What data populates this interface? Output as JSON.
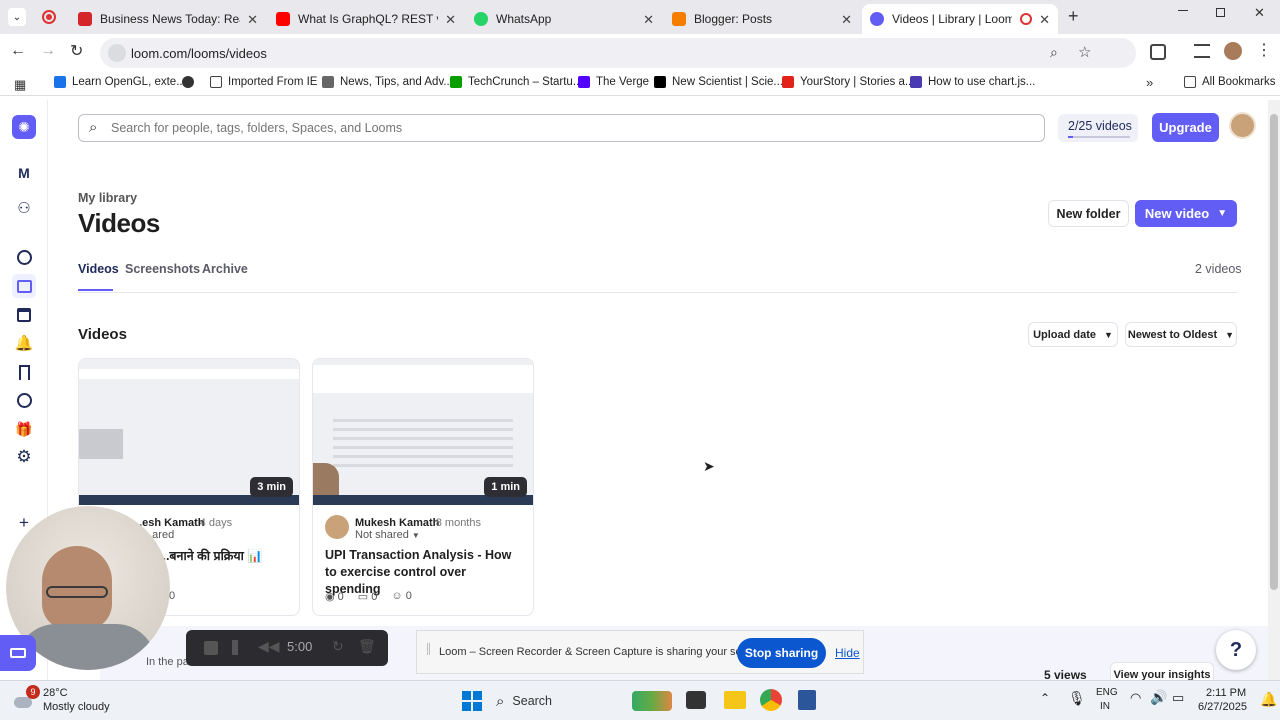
{
  "browser": {
    "tabs": [
      {
        "title": "Business News Today: Read Latest",
        "icon_color": "#d4262a"
      },
      {
        "title": "What Is GraphQL? REST vs. GraphQL",
        "icon_color": "#ff0000"
      },
      {
        "title": "WhatsApp",
        "icon_color": "#25d366"
      },
      {
        "title": "Blogger: Posts",
        "icon_color": "#f57d00"
      },
      {
        "title": "Videos | Library | Loom",
        "icon_color": "#625df5"
      }
    ],
    "url": "loom.com/looms/videos",
    "bookmarks": [
      {
        "label": "Learn OpenGL, exte..."
      },
      {
        "label": "Imported From IE"
      },
      {
        "label": "News, Tips, and Adv..."
      },
      {
        "label": "TechCrunch – Startu..."
      },
      {
        "label": "The Verge"
      },
      {
        "label": "New Scientist | Scie..."
      },
      {
        "label": "YourStory | Stories a..."
      },
      {
        "label": "How to use chart.js..."
      }
    ],
    "all_bookmarks": "All Bookmarks"
  },
  "loom": {
    "search_placeholder": "Search for people, tags, folders, Spaces, and Looms",
    "usage": "2/25 videos",
    "usage_fraction": 0.08,
    "upgrade": "Upgrade",
    "breadcrumb": "My library",
    "title": "Videos",
    "new_folder": "New folder",
    "new_video": "New video",
    "tabs": [
      "Videos",
      "Screenshots",
      "Archive"
    ],
    "video_count": "2 videos",
    "section_title": "Videos",
    "sort_field": "Upload date",
    "sort_order": "Newest to Oldest",
    "workspace_initial": "M",
    "cards": [
      {
        "duration": "3 min",
        "author": "...esh Kamath",
        "time": "4 days",
        "sharing": "...ared",
        "title": "...बनाने की प्रक्रिया 📊",
        "views": "",
        "comments": "",
        "reactions": "0"
      },
      {
        "duration": "1 min",
        "author": "Mukesh Kamath",
        "time": "8 months",
        "sharing": "Not shared",
        "title": "UPI Transaction Analysis - How to exercise control over spending",
        "views": "0",
        "comments": "0",
        "reactions": "0"
      }
    ],
    "bottom": {
      "in_the_past": "In the pas",
      "views": "5 views",
      "insights": "View your insights"
    }
  },
  "recorder": {
    "timer": "5:00",
    "share_message": "Loom – Screen Recorder & Screen Capture is sharing your screen.",
    "stop_sharing": "Stop sharing",
    "hide": "Hide",
    "help": "?"
  },
  "taskbar": {
    "weather_badge": "9",
    "temperature": "28°C",
    "condition": "Mostly cloudy",
    "search": "Search",
    "lang1": "ENG",
    "lang2": "IN",
    "time": "2:11 PM",
    "date": "6/27/2025"
  }
}
